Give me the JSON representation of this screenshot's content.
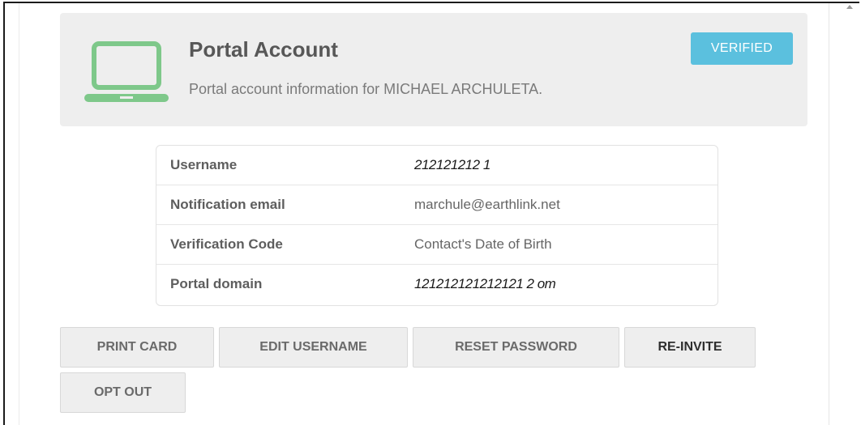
{
  "header": {
    "title": "Portal Account",
    "subtitle": "Portal account information for MICHAEL ARCHULETA.",
    "badge": "VERIFIED",
    "icon": "laptop-icon",
    "icon_color": "#7ec88a",
    "badge_color": "#5bc0de"
  },
  "info": {
    "rows": [
      {
        "label": "Username",
        "value": "212121212 1"
      },
      {
        "label": "Notification email",
        "value": "marchule@earthlink.net"
      },
      {
        "label": "Verification Code",
        "value": "Contact's Date of Birth"
      },
      {
        "label": "Portal domain",
        "value": "121212121212121 2 om"
      }
    ]
  },
  "actions": {
    "print_card": "PRINT CARD",
    "edit_username": "EDIT USERNAME",
    "reset_password": "RESET PASSWORD",
    "re_invite": "RE-INVITE",
    "opt_out": "OPT OUT"
  }
}
